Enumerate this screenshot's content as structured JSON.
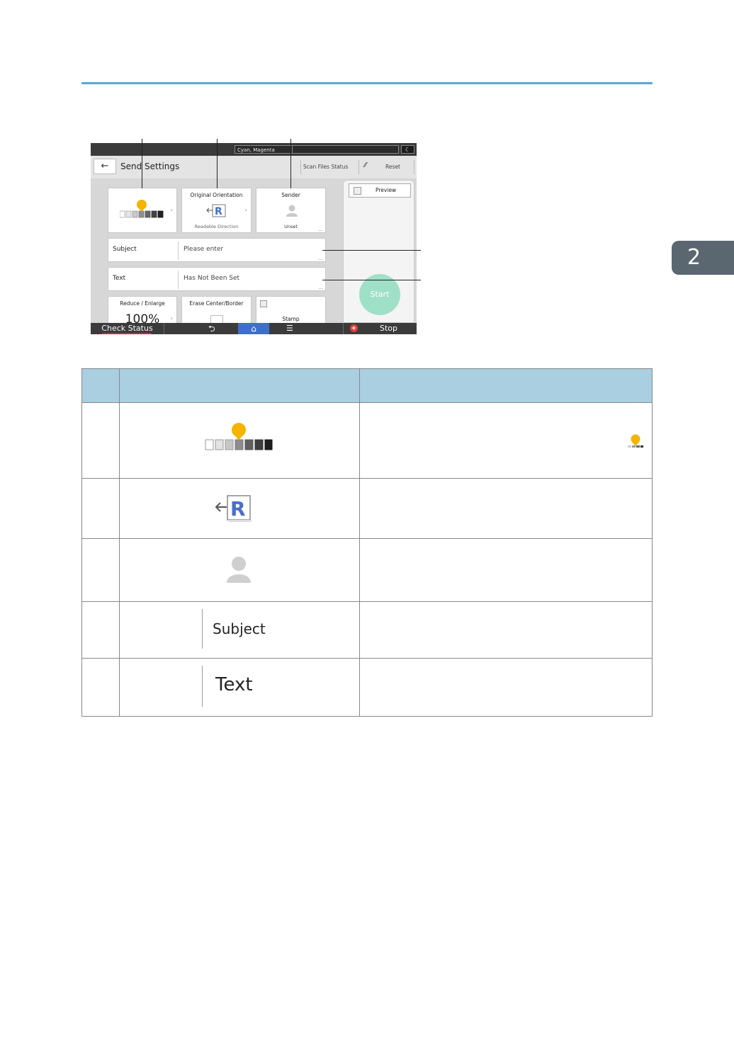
{
  "page": {
    "chapter_number": "2"
  },
  "screen": {
    "color_mode": "Cyan, Magenta",
    "moon_icon": "moon-icon",
    "title": "Send Settings",
    "scan_files_status": "Scan Files Status",
    "reset": "Reset",
    "density_card": {
      "icon": "density-scale-icon"
    },
    "orientation_card": {
      "label": "Original Orientation",
      "value": "Readable Direction",
      "icon": "orientation-r-icon"
    },
    "sender_card": {
      "label": "Sender",
      "value": "Unset",
      "icon": "person-icon"
    },
    "subject_row": {
      "label": "Subject",
      "value": "Please enter"
    },
    "text_row": {
      "label": "Text",
      "value": "Has Not Been Set"
    },
    "reduce_card": {
      "label": "Reduce / Enlarge",
      "value": "100%"
    },
    "erase_card": {
      "label": "Erase Center/Border"
    },
    "stamp_card": {
      "label": "Stamp"
    },
    "preview": "Preview",
    "start": "Start",
    "check_status": "Check Status",
    "stop": "Stop",
    "dots": "..."
  },
  "table": {
    "headers": [
      "",
      "",
      ""
    ],
    "rows": [
      {
        "icon": "density-scale-icon",
        "label": ""
      },
      {
        "icon": "orientation-r-icon",
        "label": ""
      },
      {
        "icon": "person-icon",
        "label": ""
      },
      {
        "icon": "",
        "label": "Subject"
      },
      {
        "icon": "",
        "label": "Text"
      }
    ]
  },
  "colors": {
    "accent_line": "#5aa8d6",
    "table_header": "#a9cfe0",
    "start_button": "#9fe0c8",
    "home_button": "#3f6fc9",
    "density_pin": "#f4b400",
    "chapter_tab": "#5b6770"
  }
}
